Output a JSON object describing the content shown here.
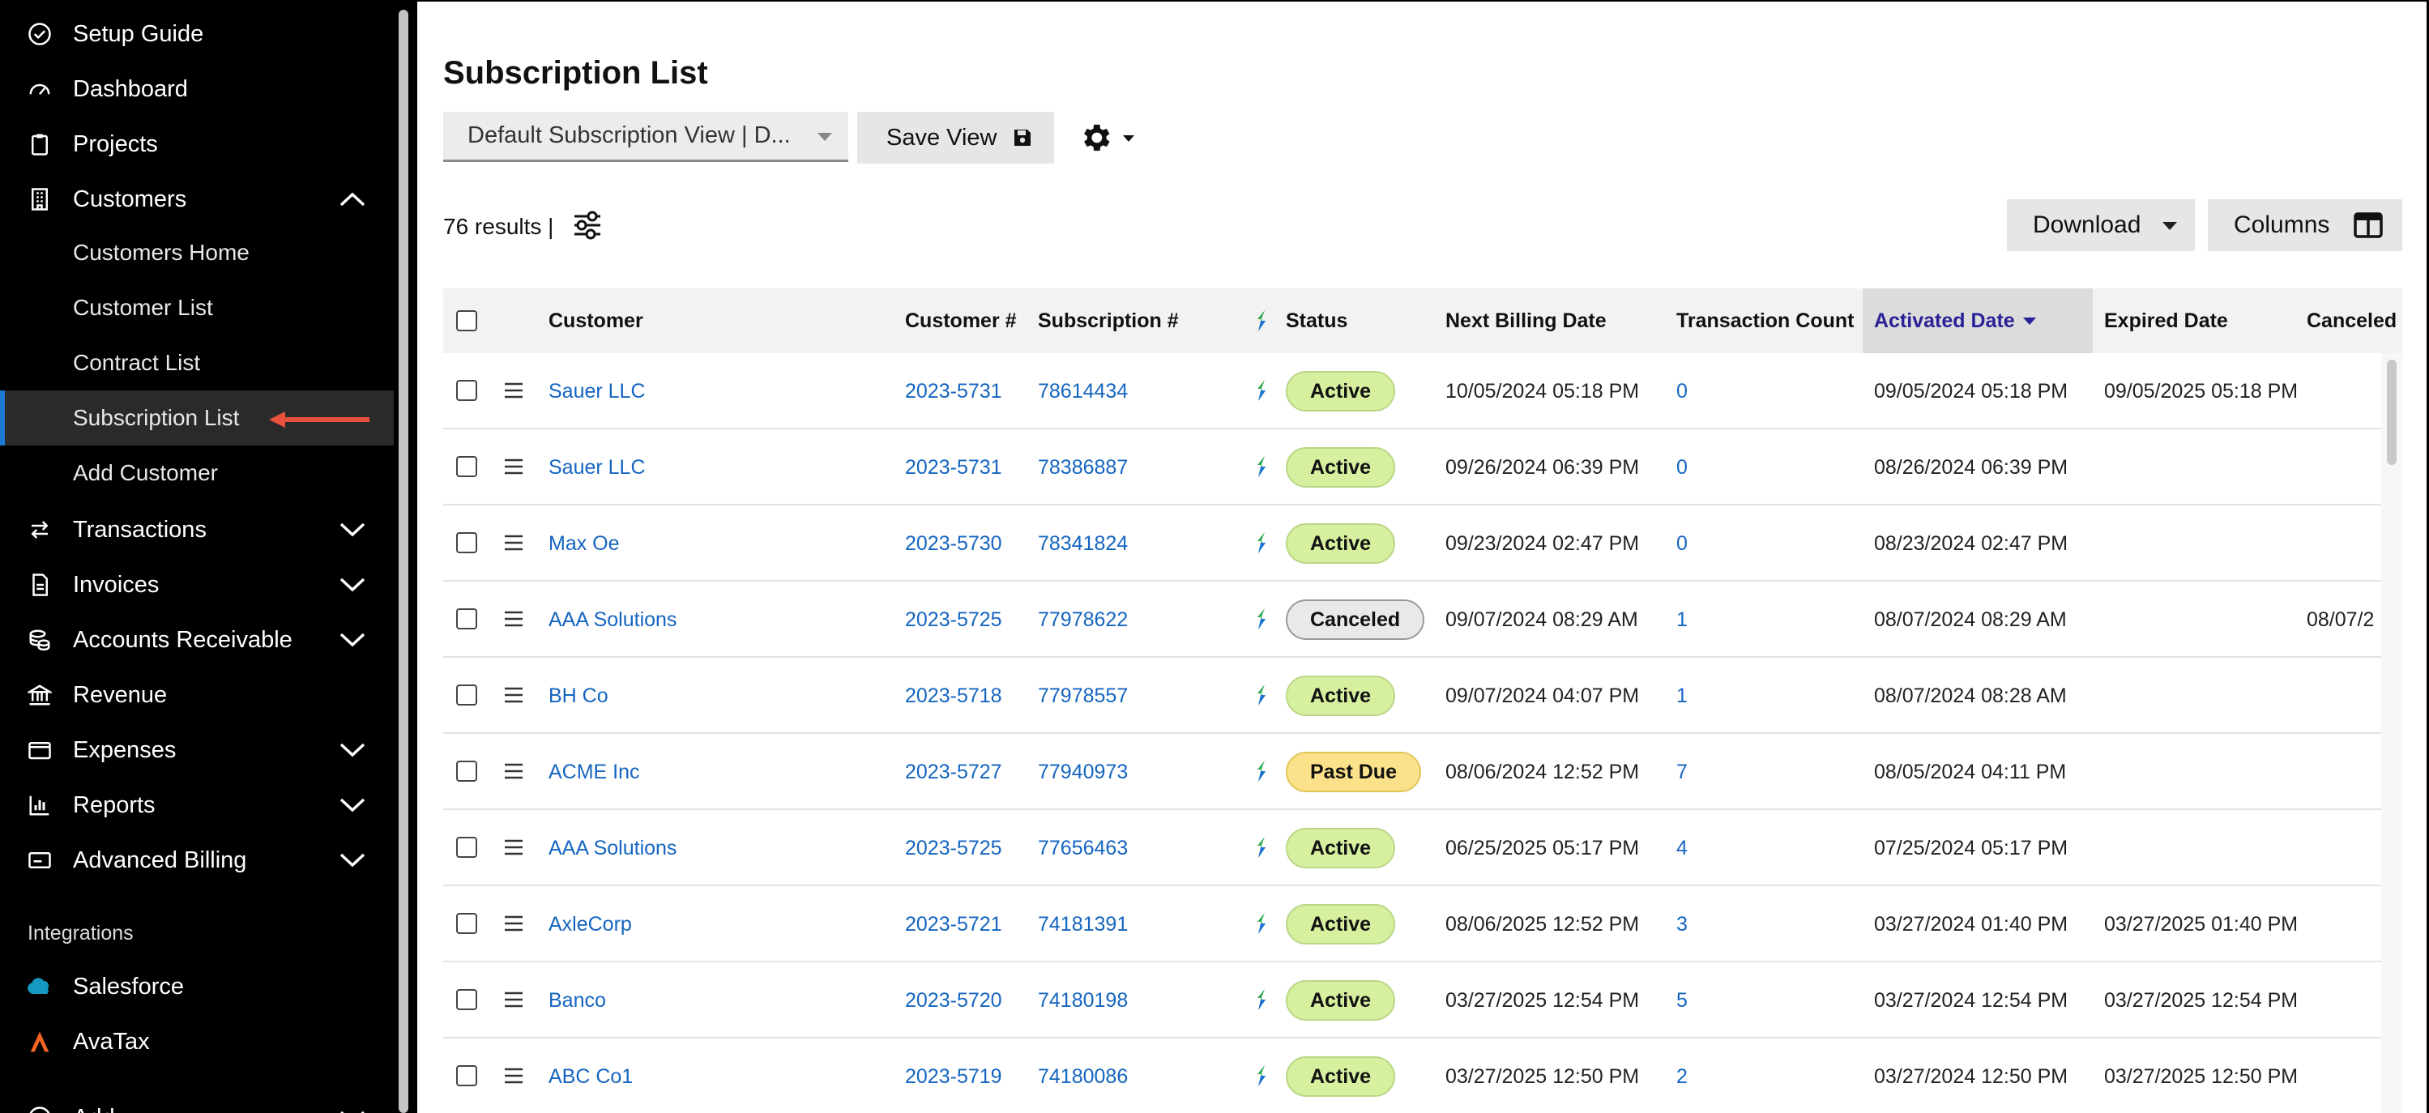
{
  "sidebar": {
    "items": [
      {
        "label": "Setup Guide",
        "icon": "check-circle-icon",
        "expandable": false
      },
      {
        "label": "Dashboard",
        "icon": "gauge-icon",
        "expandable": false
      },
      {
        "label": "Projects",
        "icon": "clipboard-icon",
        "expandable": false
      },
      {
        "label": "Customers",
        "icon": "building-icon",
        "expandable": true,
        "expanded": true
      },
      {
        "label": "Transactions",
        "icon": "transfer-arrows-icon",
        "expandable": true,
        "expanded": false
      },
      {
        "label": "Invoices",
        "icon": "document-icon",
        "expandable": true,
        "expanded": false
      },
      {
        "label": "Accounts Receivable",
        "icon": "coins-icon",
        "expandable": true,
        "expanded": false
      },
      {
        "label": "Revenue",
        "icon": "bank-icon",
        "expandable": false
      },
      {
        "label": "Expenses",
        "icon": "wallet-icon",
        "expandable": true,
        "expanded": false
      },
      {
        "label": "Reports",
        "icon": "bar-chart-icon",
        "expandable": true,
        "expanded": false
      },
      {
        "label": "Advanced Billing",
        "icon": "billing-card-icon",
        "expandable": true,
        "expanded": false
      }
    ],
    "customers_sub": [
      {
        "label": "Customers Home"
      },
      {
        "label": "Customer List"
      },
      {
        "label": "Contract List"
      },
      {
        "label": "Subscription List",
        "active": true
      },
      {
        "label": "Add Customer"
      }
    ],
    "integrations_heading": "Integrations",
    "integrations": [
      {
        "label": "Salesforce",
        "icon": "salesforce-cloud-icon",
        "color": "#1798c1"
      },
      {
        "label": "AvaTax",
        "icon": "avatax-icon",
        "color": "#f26522"
      }
    ],
    "clipped_item": "Add",
    "arrow_color": "#e8513e",
    "active_indicator_color": "#1e78d6"
  },
  "main": {
    "title": "Subscription List",
    "view_select": "Default Subscription View | D...",
    "save_view_label": "Save View",
    "results_text": "76 results |",
    "download_label": "Download",
    "columns_label": "Columns"
  },
  "table": {
    "headers": {
      "customer": "Customer",
      "customer_no": "Customer #",
      "subscription_no": "Subscription #",
      "status": "Status",
      "next_billing": "Next Billing Date",
      "transaction_count": "Transaction Count",
      "activated": "Activated Date",
      "expired": "Expired Date",
      "canceled": "Canceled I"
    },
    "rows": [
      {
        "customer": "Sauer LLC",
        "customer_no": "2023-5731",
        "subscription_no": "78614434",
        "status": "Active",
        "next_billing": "10/05/2024 05:18 PM",
        "transaction_count": "0",
        "activated": "09/05/2024 05:18 PM",
        "expired": "09/05/2025 05:18 PM",
        "canceled": ""
      },
      {
        "customer": "Sauer LLC",
        "customer_no": "2023-5731",
        "subscription_no": "78386887",
        "status": "Active",
        "next_billing": "09/26/2024 06:39 PM",
        "transaction_count": "0",
        "activated": "08/26/2024 06:39 PM",
        "expired": "",
        "canceled": ""
      },
      {
        "customer": "Max Oe",
        "customer_no": "2023-5730",
        "subscription_no": "78341824",
        "status": "Active",
        "next_billing": "09/23/2024 02:47 PM",
        "transaction_count": "0",
        "activated": "08/23/2024 02:47 PM",
        "expired": "",
        "canceled": ""
      },
      {
        "customer": "AAA Solutions",
        "customer_no": "2023-5725",
        "subscription_no": "77978622",
        "status": "Canceled",
        "next_billing": "09/07/2024 08:29 AM",
        "transaction_count": "1",
        "activated": "08/07/2024 08:29 AM",
        "expired": "",
        "canceled": "08/07/2"
      },
      {
        "customer": "BH Co",
        "customer_no": "2023-5718",
        "subscription_no": "77978557",
        "status": "Active",
        "next_billing": "09/07/2024 04:07 PM",
        "transaction_count": "1",
        "activated": "08/07/2024 08:28 AM",
        "expired": "",
        "canceled": ""
      },
      {
        "customer": "ACME Inc",
        "customer_no": "2023-5727",
        "subscription_no": "77940973",
        "status": "Past Due",
        "next_billing": "08/06/2024 12:52 PM",
        "transaction_count": "7",
        "activated": "08/05/2024 04:11 PM",
        "expired": "",
        "canceled": ""
      },
      {
        "customer": "AAA Solutions",
        "customer_no": "2023-5725",
        "subscription_no": "77656463",
        "status": "Active",
        "next_billing": "06/25/2025 05:17 PM",
        "transaction_count": "4",
        "activated": "07/25/2024 05:17 PM",
        "expired": "",
        "canceled": ""
      },
      {
        "customer": "AxleCorp",
        "customer_no": "2023-5721",
        "subscription_no": "74181391",
        "status": "Active",
        "next_billing": "08/06/2025 12:52 PM",
        "transaction_count": "3",
        "activated": "03/27/2024 01:40 PM",
        "expired": "03/27/2025 01:40 PM",
        "canceled": ""
      },
      {
        "customer": "Banco",
        "customer_no": "2023-5720",
        "subscription_no": "74180198",
        "status": "Active",
        "next_billing": "03/27/2025 12:54 PM",
        "transaction_count": "5",
        "activated": "03/27/2024 12:54 PM",
        "expired": "03/27/2025 12:54 PM",
        "canceled": ""
      },
      {
        "customer": "ABC Co1",
        "customer_no": "2023-5719",
        "subscription_no": "74180086",
        "status": "Active",
        "next_billing": "03/27/2025 12:50 PM",
        "transaction_count": "2",
        "activated": "03/27/2024 12:50 PM",
        "expired": "03/27/2025 12:50 PM",
        "canceled": ""
      }
    ],
    "status_colors": {
      "Active": {
        "bg": "#d7f0a0",
        "border": "#b9d786"
      },
      "Canceled": {
        "bg": "#e9e9e9",
        "border": "#9a9a9a"
      },
      "Past Due": {
        "bg": "#fbe28a",
        "border": "#e2c55a"
      }
    },
    "link_color": "#1565c0",
    "sorted_header_color": "#2a2196"
  }
}
